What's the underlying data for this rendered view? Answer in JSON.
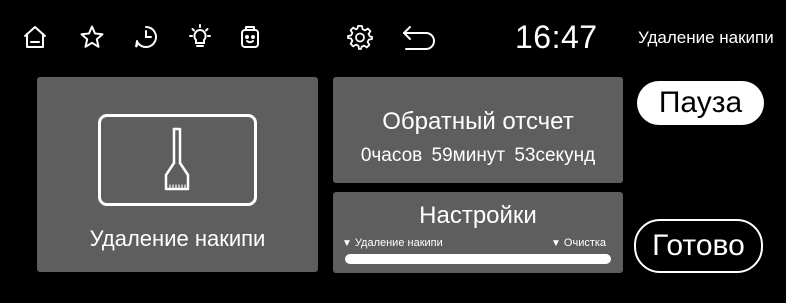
{
  "topbar": {
    "icons": [
      "home-icon",
      "star-icon",
      "clock-icon",
      "light-bulb-icon",
      "appliance-icon",
      "gear-icon",
      "back-arrow-icon"
    ],
    "time": "16:47",
    "mode_title": "Удаление накипи"
  },
  "program": {
    "icon": "descaling-brush-icon",
    "label": "Удаление накипи"
  },
  "countdown": {
    "title": "Обратный отсчет",
    "hours": "0часов",
    "minutes": "59минут",
    "seconds": "53секунд"
  },
  "settings": {
    "title": "Настройки",
    "step_left": "Удаление накипи",
    "step_right": "Очистка",
    "progress": 1.0
  },
  "buttons": {
    "pause": "Пауза",
    "done": "Готово"
  }
}
